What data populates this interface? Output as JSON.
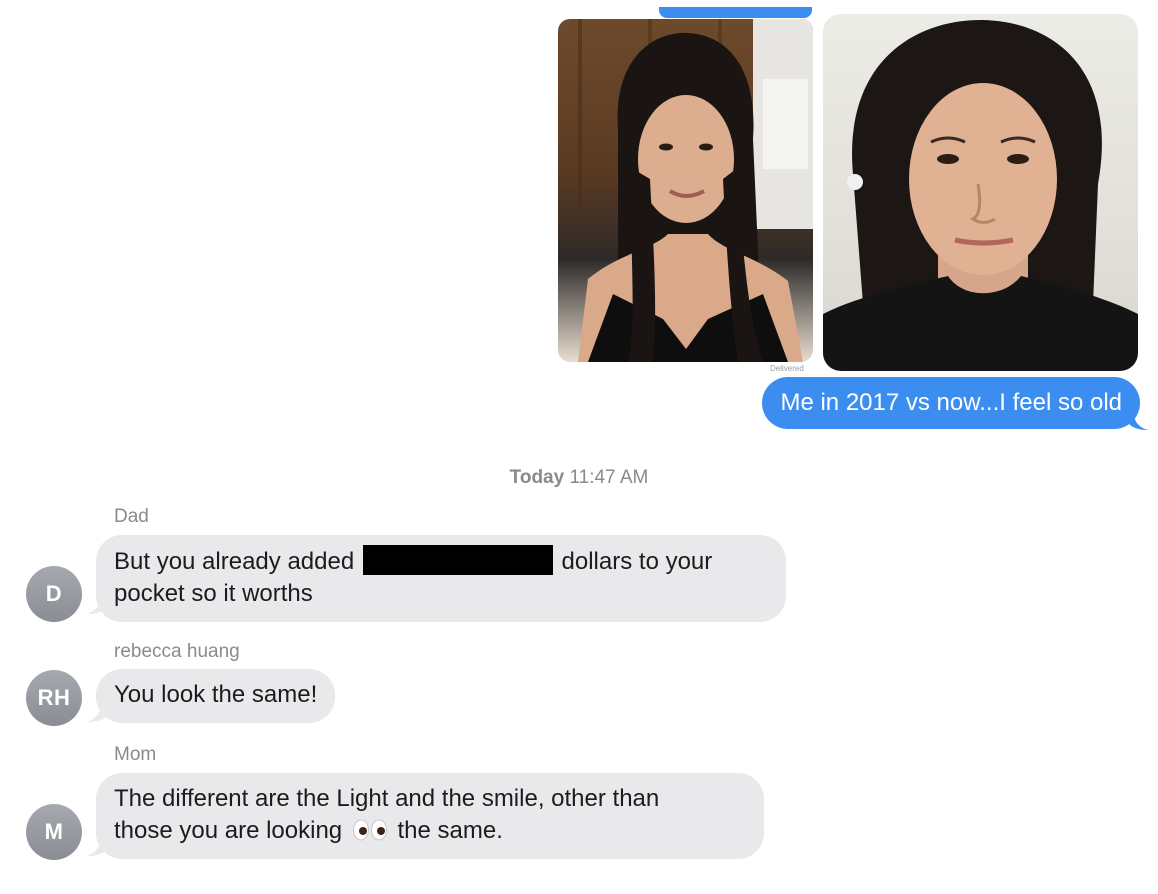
{
  "conversation": {
    "sent_message": "Me in 2017 vs now...I feel so old",
    "delivered_label": "Delivered",
    "timestamp_day": "Today",
    "timestamp_time": "11:47 AM",
    "messages": [
      {
        "sender": "Dad",
        "initials": "D",
        "text_before": "But you already added",
        "text_after": "dollars to your",
        "text_line2": "pocket so it worths"
      },
      {
        "sender": "rebecca huang",
        "initials": "RH",
        "text": "You look the same!"
      },
      {
        "sender": "Mom",
        "initials": "M",
        "text_line1": "The different are the Light and the smile, other than",
        "text_line2_before": "those you are looking",
        "text_line2_after": "the same."
      }
    ]
  },
  "colors": {
    "sent_bubble": "#3b8ef0",
    "received_bubble": "#e9e9eb",
    "avatar": "#9a9da3"
  },
  "icons": {
    "eyes_emoji": "eyes-icon"
  }
}
